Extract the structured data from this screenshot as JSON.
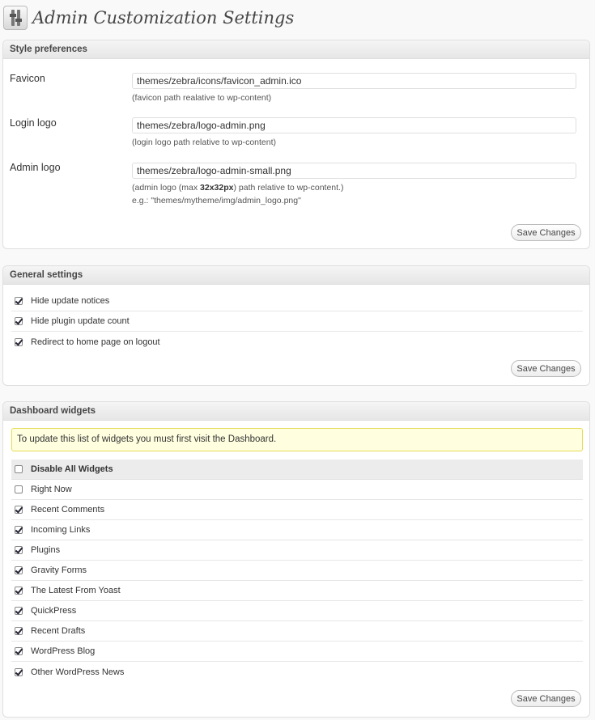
{
  "page": {
    "title": "Admin Customization Settings"
  },
  "style_preferences": {
    "title": "Style preferences",
    "fields": [
      {
        "label": "Favicon",
        "value": "themes/zebra/icons/favicon_admin.ico",
        "desc": "(favicon path realative to wp-content)"
      },
      {
        "label": "Login logo",
        "value": "themes/zebra/logo-admin.png",
        "desc": "(login logo path relative to wp-content)"
      },
      {
        "label": "Admin logo",
        "value": "themes/zebra/logo-admin-small.png",
        "desc_pre": "(admin logo (max ",
        "desc_bold": "32x32px",
        "desc_post": ") path relative to wp-content.)",
        "desc_example": "e.g.: \"themes/mytheme/img/admin_logo.png\""
      }
    ],
    "save_label": "Save Changes"
  },
  "general_settings": {
    "title": "General settings",
    "items": [
      {
        "label": "Hide update notices",
        "checked": true
      },
      {
        "label": "Hide plugin update count",
        "checked": true
      },
      {
        "label": "Redirect to home page on logout",
        "checked": true
      }
    ],
    "save_label": "Save Changes"
  },
  "dashboard_widgets": {
    "title": "Dashboard widgets",
    "notice": "To update this list of widgets you must first visit the Dashboard.",
    "disable_all": {
      "label": "Disable All Widgets",
      "checked": false
    },
    "items": [
      {
        "label": "Right Now",
        "checked": false
      },
      {
        "label": "Recent Comments",
        "checked": true
      },
      {
        "label": "Incoming Links",
        "checked": true
      },
      {
        "label": "Plugins",
        "checked": true
      },
      {
        "label": "Gravity Forms",
        "checked": true
      },
      {
        "label": "The Latest From Yoast",
        "checked": true
      },
      {
        "label": "QuickPress",
        "checked": true
      },
      {
        "label": "Recent Drafts",
        "checked": true
      },
      {
        "label": "WordPress Blog",
        "checked": true
      },
      {
        "label": "Other WordPress News",
        "checked": true
      }
    ],
    "save_label": "Save Changes"
  }
}
